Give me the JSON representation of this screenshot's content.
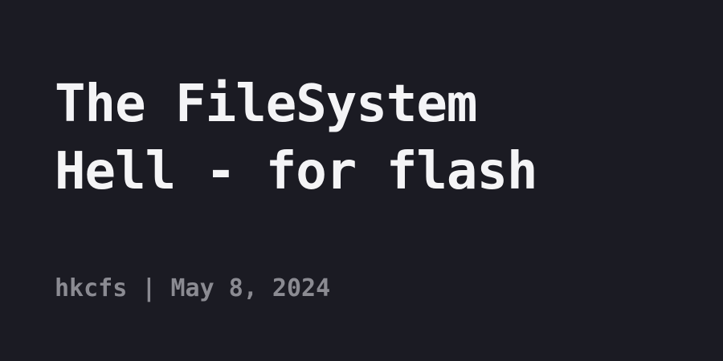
{
  "post": {
    "title_line_1": "The FileSystem",
    "title_line_2": "Hell - for flash",
    "author": "hkcfs",
    "separator": " | ",
    "date": "May 8, 2024"
  },
  "colors": {
    "background": "#1b1b23",
    "title": "#f4f4f6",
    "meta": "#8b8b92"
  }
}
